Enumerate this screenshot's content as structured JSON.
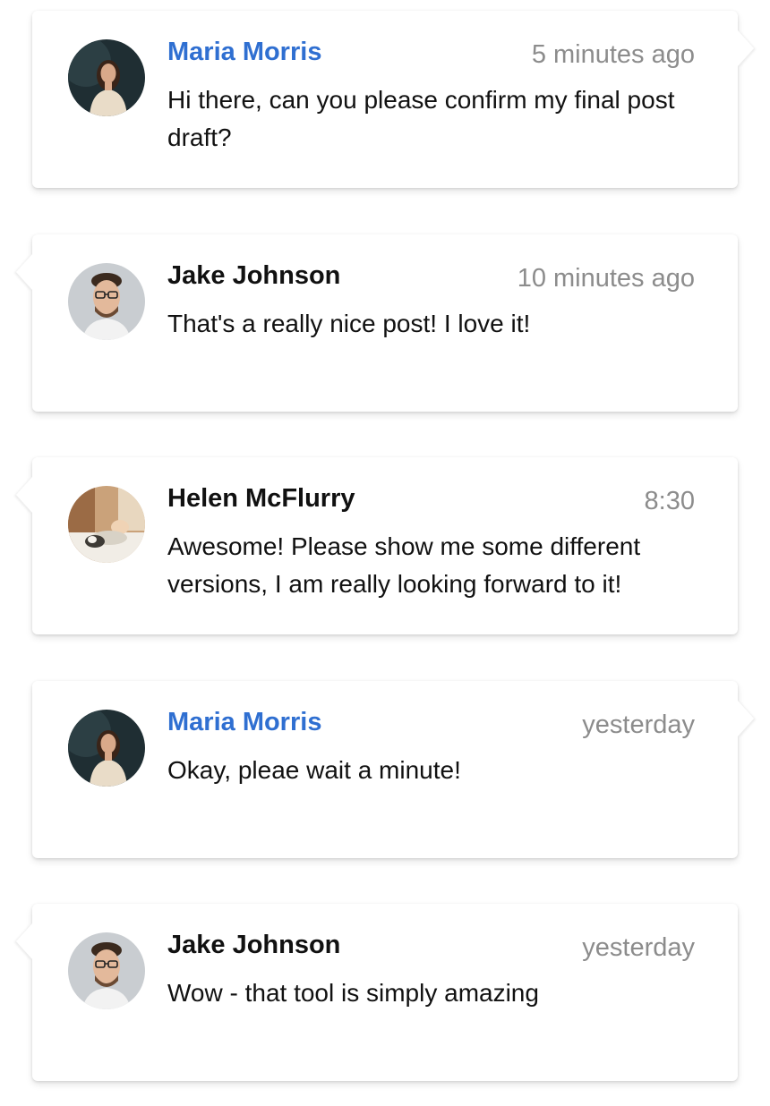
{
  "messages": [
    {
      "author": "Maria Morris",
      "time": "5 minutes ago",
      "text": "Hi there, can you please confirm my final post draft?",
      "author_color": "#2f6fd1",
      "avatar": "woman-portrait-dark",
      "tail": "right"
    },
    {
      "author": "Jake Johnson",
      "time": "10 minutes ago",
      "text": "That's a really nice post! I love it!",
      "author_color": "#111111",
      "avatar": "man-portrait-glasses",
      "tail": "left"
    },
    {
      "author": "Helen McFlurry",
      "time": "8:30",
      "text": "Awesome! Please show me some different versions, I am really looking forward to it!",
      "author_color": "#111111",
      "avatar": "woman-with-dog",
      "tail": "left"
    },
    {
      "author": "Maria Morris",
      "time": "yesterday",
      "text": "Okay, pleae wait a minute!",
      "author_color": "#2f6fd1",
      "avatar": "woman-portrait-dark",
      "tail": "right"
    },
    {
      "author": "Jake Johnson",
      "time": "yesterday",
      "text": "Wow - that tool is simply amazing",
      "author_color": "#111111",
      "avatar": "man-portrait-glasses",
      "tail": "left"
    }
  ]
}
